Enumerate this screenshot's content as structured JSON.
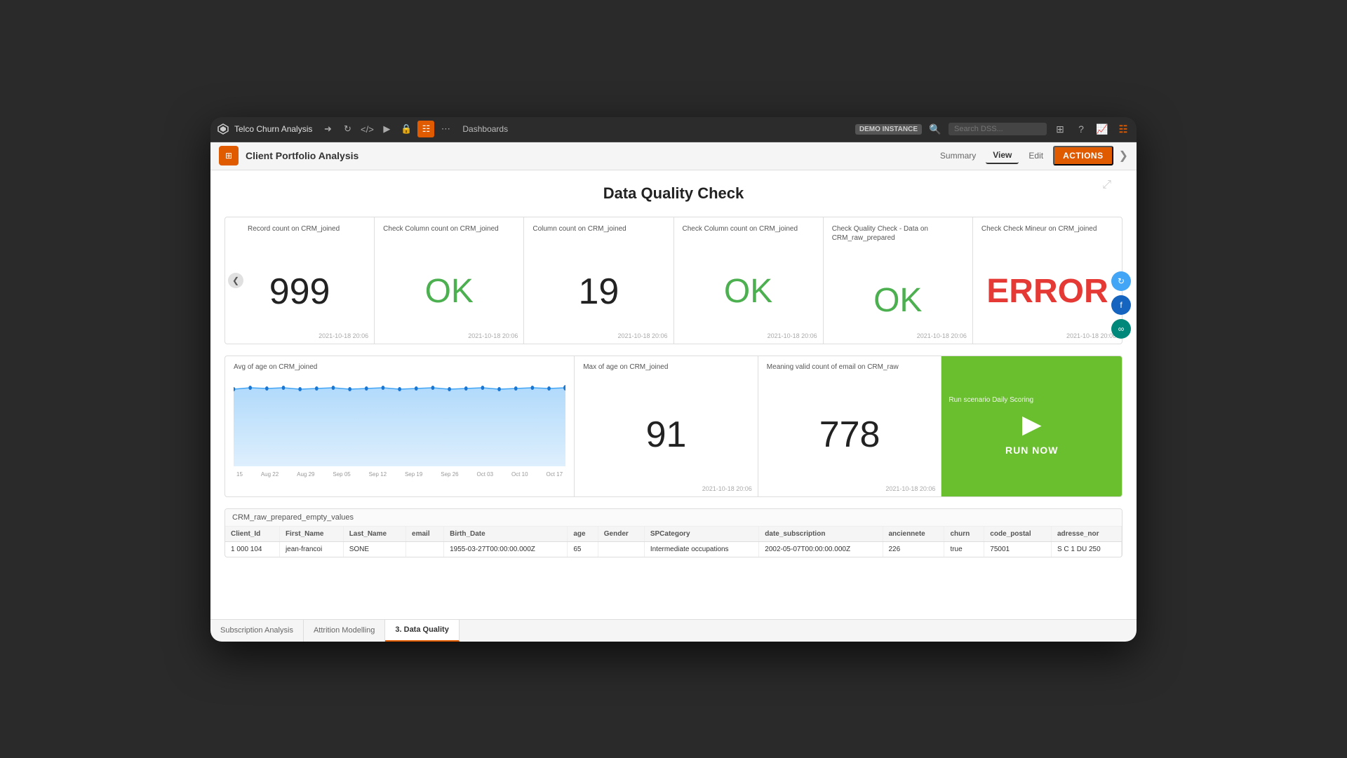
{
  "nav": {
    "project_name": "Telco Churn Analysis",
    "demo_badge": "DEMO INSTANCE",
    "search_placeholder": "Search DSS...",
    "dashboards_label": "Dashboards",
    "icons": [
      "share",
      "refresh",
      "code",
      "play",
      "lock",
      "grid",
      "more"
    ]
  },
  "toolbar": {
    "logo_icon": "⊞",
    "title": "Client Portfolio Analysis",
    "tabs": [
      {
        "label": "Summary",
        "active": false
      },
      {
        "label": "View",
        "active": true
      },
      {
        "label": "Edit",
        "active": false
      }
    ],
    "actions_label": "ACTIONS"
  },
  "page": {
    "title": "Data Quality Check",
    "expand_icon": "⤢"
  },
  "metrics": [
    {
      "label": "Record count on CRM_joined",
      "value": "999",
      "type": "number",
      "timestamp": "2021-10-18 20:06"
    },
    {
      "label": "Check Column count on CRM_joined",
      "value": "OK",
      "type": "ok",
      "timestamp": "2021-10-18 20:06"
    },
    {
      "label": "Column count on CRM_joined",
      "value": "19",
      "type": "number",
      "timestamp": "2021-10-18 20:06"
    },
    {
      "label": "Check Column count on CRM_joined",
      "value": "OK",
      "type": "ok",
      "timestamp": "2021-10-18 20:06"
    },
    {
      "label": "Check Quality Check - Data on CRM_raw_prepared",
      "value": "OK",
      "type": "ok",
      "timestamp": "2021-10-18 20:06"
    },
    {
      "label": "Check Check Mineur on CRM_joined",
      "value": "ERROR",
      "type": "error",
      "timestamp": "2021-10-18 20:06"
    }
  ],
  "charts": [
    {
      "label": "Avg of age on CRM_joined",
      "type": "area",
      "x_labels": [
        "15",
        "Aug 22",
        "Aug 29",
        "Sep 05",
        "Sep 12",
        "Sep 19",
        "Sep 26",
        "Oct 03",
        "Oct 10",
        "Oct 17"
      ]
    },
    {
      "label": "Max of age on CRM_joined",
      "value": "91",
      "type": "number",
      "timestamp": "2021-10-18 20:06"
    },
    {
      "label": "Meaning valid count of email on CRM_raw",
      "value": "778",
      "type": "number",
      "timestamp": "2021-10-18 20:06"
    },
    {
      "label": "Run scenario Daily Scoring",
      "type": "run_now",
      "button_text": "RUN NOW"
    }
  ],
  "table": {
    "title": "CRM_raw_prepared_empty_values",
    "columns": [
      "Client_Id",
      "First_Name",
      "Last_Name",
      "email",
      "Birth_Date",
      "age",
      "Gender",
      "SPCategory",
      "date_subscription",
      "anciennete",
      "churn",
      "code_postal",
      "adresse_nor"
    ],
    "rows": [
      [
        "1 000 104",
        "jean-francoi",
        "SONE",
        "",
        "1955-03-27T00:00:00.000Z",
        "65",
        "",
        "Intermediate occupations",
        "2002-05-07T00:00:00.000Z",
        "226",
        "true",
        "75001",
        "S C 1 DU 250"
      ]
    ]
  },
  "bottom_tabs": [
    {
      "label": "Subscription Analysis",
      "active": false
    },
    {
      "label": "Attrition Modelling",
      "active": false
    },
    {
      "label": "3. Data Quality",
      "active": true
    }
  ]
}
